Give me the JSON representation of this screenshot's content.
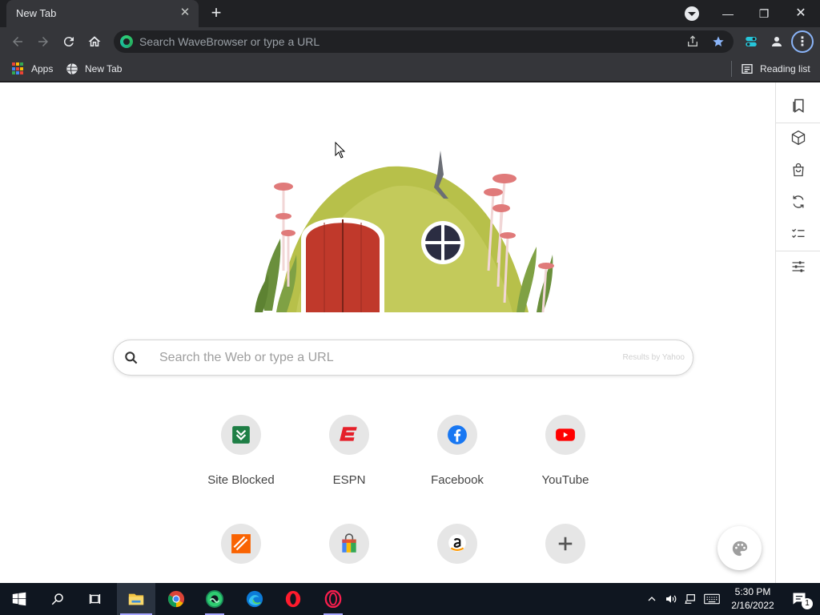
{
  "browser": {
    "tab": {
      "title": "New Tab",
      "close_glyph": "✕"
    },
    "new_tab_glyph": "+",
    "window_controls": {
      "minimize": "—",
      "maximize": "❐",
      "close": "✕"
    },
    "omnibox": {
      "placeholder": "Search WaveBrowser or type a URL"
    },
    "bookmarks": [
      {
        "label": "Apps",
        "icon": "apps-grid-icon"
      },
      {
        "label": "New Tab",
        "icon": "globe-icon"
      }
    ],
    "reading_list": {
      "label": "Reading list",
      "icon": "reading-list-icon"
    },
    "menu_glyph": "⋮",
    "accent_color": "#8ab4f8"
  },
  "page": {
    "search": {
      "placeholder": "Search the Web or type a URL",
      "attribution": "Results by Yahoo"
    },
    "tiles": [
      {
        "label": "Site Blocked",
        "icon": "site-blocked-icon"
      },
      {
        "label": "ESPN",
        "icon": "espn-icon"
      },
      {
        "label": "Facebook",
        "icon": "facebook-icon"
      },
      {
        "label": "YouTube",
        "icon": "youtube-icon"
      },
      {
        "label": "",
        "icon": "home-depot-icon"
      },
      {
        "label": "",
        "icon": "shopping-bag-icon"
      },
      {
        "label": "",
        "icon": "amazon-icon"
      },
      {
        "label": "",
        "icon": "add-shortcut-icon"
      }
    ],
    "side_panel": [
      "bookmark-icon",
      "cube-icon",
      "shopping-bag-icon",
      "refresh-icon",
      "checklist-icon",
      "sliders-icon"
    ],
    "customize_icon": "palette-icon"
  },
  "taskbar": {
    "apps": [
      "start-icon",
      "search-icon",
      "task-view-icon",
      "file-explorer-icon",
      "chrome-icon",
      "wavebrowser-icon",
      "edge-icon",
      "opera-icon",
      "opera-gx-icon"
    ],
    "clock": {
      "time": "5:30 PM",
      "date": "2/16/2022"
    },
    "notification_count": "1"
  }
}
